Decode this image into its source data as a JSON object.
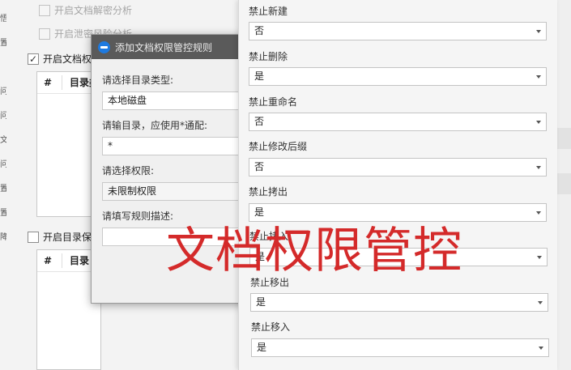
{
  "background": {
    "options": [
      {
        "label": "开启文档解密分析",
        "checked": false,
        "disabled": true
      },
      {
        "label": "开启泄密风险分析",
        "checked": false,
        "disabled": true
      },
      {
        "label": "开启文档权",
        "checked": true,
        "disabled": false
      },
      {
        "label": "开启目录保",
        "checked": false,
        "disabled": false
      }
    ],
    "table1": {
      "headers": [
        "#",
        "目录类"
      ]
    },
    "table2": {
      "headers": [
        "#",
        "目录"
      ]
    },
    "left_strip": [
      "悟",
      "置",
      "问",
      "问",
      "文",
      "问",
      "置",
      "置",
      "降"
    ]
  },
  "dialog": {
    "title": "添加文档权限管控规则",
    "dir_type_label": "请选择目录类型:",
    "dir_type_value": "本地磁盘",
    "dir_input_label": "请输目录，应使用*通配:",
    "dir_input_value": "*",
    "perm_label": "请选择权限:",
    "perm_value": "未限制权限",
    "desc_label": "请填写规则描述:",
    "desc_value": ""
  },
  "panel": {
    "rows": [
      {
        "label": "禁止新建",
        "value": "否"
      },
      {
        "label": "禁止删除",
        "value": "是"
      },
      {
        "label": "禁止重命名",
        "value": "否"
      },
      {
        "label": "禁止修改后缀",
        "value": "否"
      },
      {
        "label": "禁止拷出",
        "value": "是"
      },
      {
        "label": "禁止拷入",
        "value": "是"
      },
      {
        "label": "禁止移出",
        "value": "是"
      },
      {
        "label": "禁止移入",
        "value": "是"
      }
    ]
  },
  "overlay_text": "文档权限管控",
  "colors": {
    "overlay": "#d42a2a",
    "title_bar": "#5a5a5a",
    "app_icon": "#1e7ae0"
  }
}
